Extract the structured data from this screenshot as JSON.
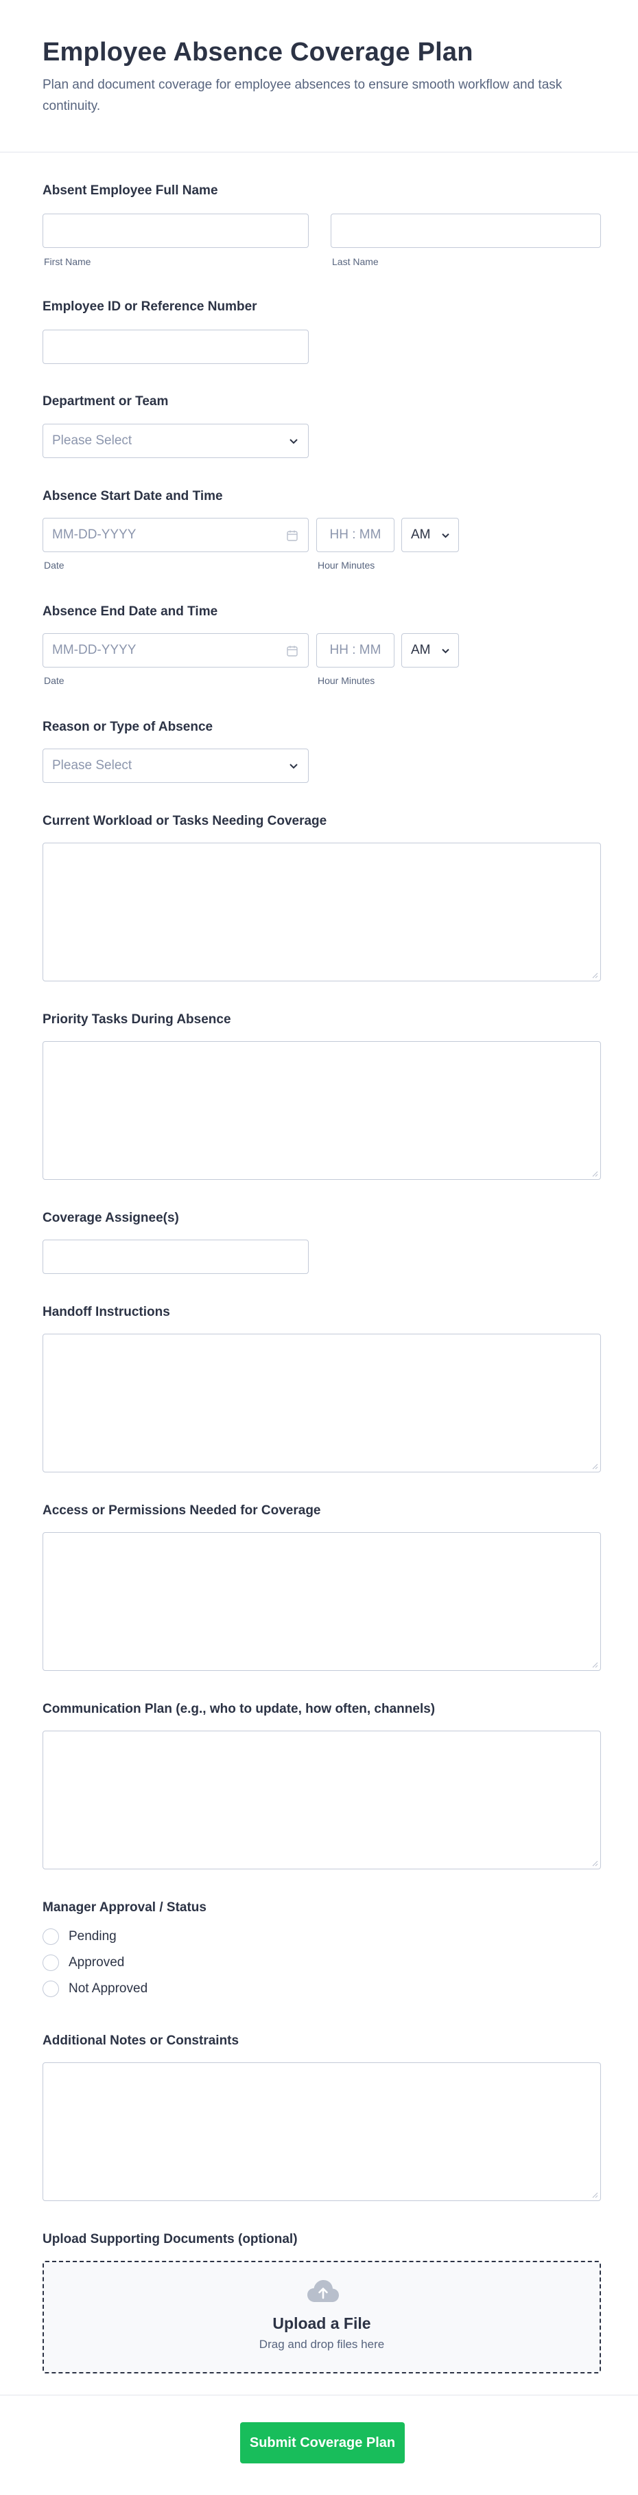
{
  "header": {
    "title": "Employee Absence Coverage Plan",
    "description": "Plan and document coverage for employee absences to ensure smooth workflow and task continuity."
  },
  "fields": {
    "full_name": {
      "label": "Absent Employee Full Name",
      "first_sublabel": "First Name",
      "last_sublabel": "Last Name",
      "first_value": "",
      "last_value": ""
    },
    "employee_id": {
      "label": "Employee ID or Reference Number",
      "value": ""
    },
    "department": {
      "label": "Department or Team",
      "selected": "Please Select"
    },
    "start": {
      "label": "Absence Start Date and Time",
      "date_placeholder": "MM-DD-YYYY",
      "time_placeholder": "HH : MM",
      "ampm": "AM",
      "date_sublabel": "Date",
      "time_sublabel": "Hour Minutes"
    },
    "end": {
      "label": "Absence End Date and Time",
      "date_placeholder": "MM-DD-YYYY",
      "time_placeholder": "HH : MM",
      "ampm": "AM",
      "date_sublabel": "Date",
      "time_sublabel": "Hour Minutes"
    },
    "reason": {
      "label": "Reason or Type of Absence",
      "selected": "Please Select"
    },
    "workload": {
      "label": "Current Workload or Tasks Needing Coverage",
      "value": ""
    },
    "priority": {
      "label": "Priority Tasks During Absence",
      "value": ""
    },
    "assignee": {
      "label": "Coverage Assignee(s)",
      "value": ""
    },
    "handoff": {
      "label": "Handoff Instructions",
      "value": ""
    },
    "access": {
      "label": "Access or Permissions Needed for Coverage",
      "value": ""
    },
    "communication": {
      "label": "Communication Plan (e.g., who to update, how often, channels)",
      "value": ""
    },
    "approval": {
      "label": "Manager Approval / Status",
      "options": [
        "Pending",
        "Approved",
        "Not Approved"
      ]
    },
    "notes": {
      "label": "Additional Notes or Constraints",
      "value": ""
    },
    "upload": {
      "label": "Upload Supporting Documents (optional)",
      "title": "Upload a File",
      "subtitle": "Drag and drop files here",
      "icon": "cloud-upload-icon"
    }
  },
  "submit": {
    "label": "Submit Coverage Plan"
  },
  "colors": {
    "accent": "#18bd5b",
    "text": "#2c3345",
    "muted": "#57647e",
    "placeholder": "#8c96ad",
    "border": "#c3cad8"
  }
}
